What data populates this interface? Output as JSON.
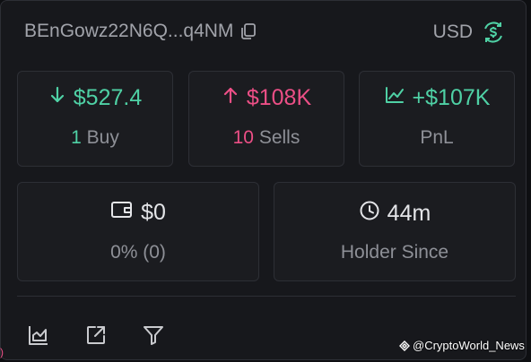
{
  "header": {
    "address": "BEnGowz22N6Q...q4NM",
    "currency": "USD"
  },
  "stats": {
    "buy": {
      "amount": "$527.4",
      "count": "1",
      "label": "Buy"
    },
    "sell": {
      "amount": "$108K",
      "count": "10",
      "label": "Sells"
    },
    "pnl": {
      "amount": "+$107K",
      "label": "PnL"
    },
    "balance": {
      "amount": "$0",
      "sub": "0% (0)"
    },
    "holder": {
      "amount": "44m",
      "label": "Holder Since"
    }
  },
  "footer": {
    "icons": [
      "chart-icon",
      "external-link-icon",
      "filter-icon"
    ]
  },
  "watermark": "@CryptoWorld_News",
  "colors": {
    "positive": "#4fd1a5",
    "negative": "#ec4f86",
    "muted": "#8e9097",
    "text": "#e4e5e8"
  }
}
